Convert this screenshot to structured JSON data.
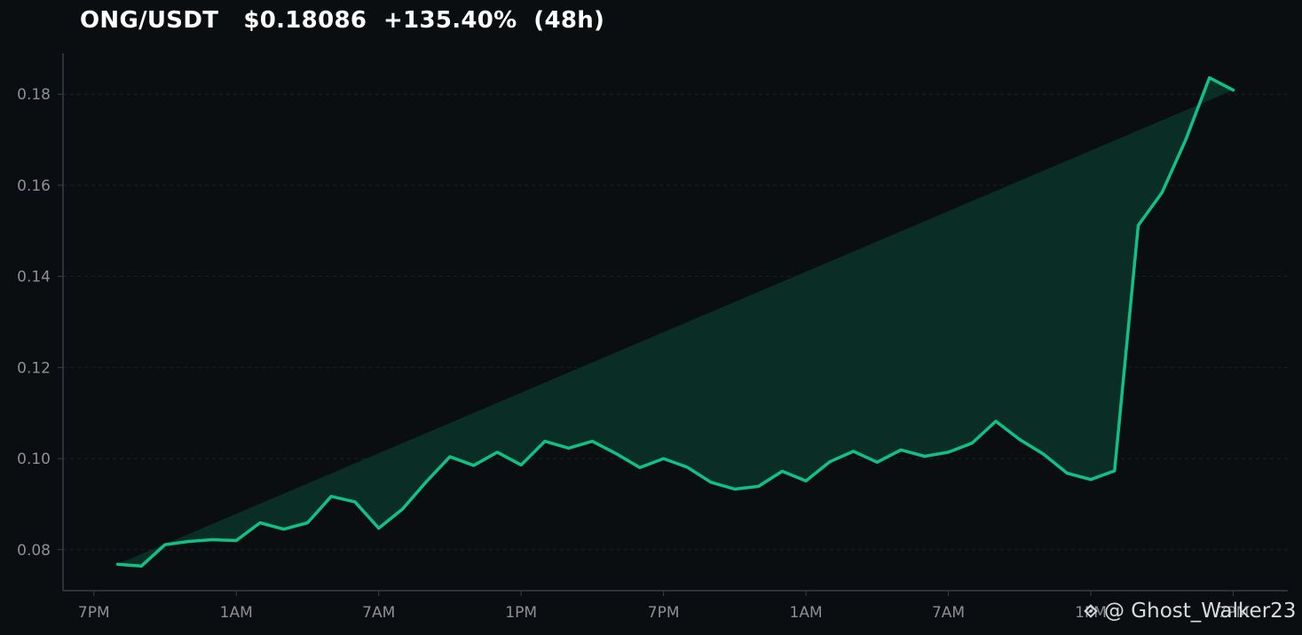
{
  "header": {
    "pair": "ONG/USDT",
    "price": "$0.18086",
    "change": "+135.40%",
    "period": "(48h)"
  },
  "watermark": {
    "handle": "@ Ghost_Walker23",
    "icon": "binance-logo-icon"
  },
  "colors": {
    "background": "#0b0e11",
    "line": "#10c184",
    "fill": "#0a2e25",
    "grid": "#1c2024",
    "axis": "#3a3f45",
    "tick_text": "#8a9096"
  },
  "chart_data": {
    "type": "area",
    "title": "ONG/USDT   $0.18086  +135.40%  (48h)",
    "xlabel": "",
    "ylabel": "",
    "x": [
      -1,
      0,
      1,
      2,
      3,
      4,
      5,
      6,
      7,
      8,
      9,
      10,
      11,
      12,
      13,
      14,
      15,
      16,
      17,
      18,
      19,
      20,
      21,
      22,
      23,
      24,
      25,
      26,
      27,
      28,
      29,
      30,
      31,
      32,
      33,
      34,
      35,
      36,
      37,
      38,
      39,
      40,
      41,
      42,
      43,
      44,
      45,
      46,
      47
    ],
    "y": [
      0.0768,
      0.0764,
      0.0811,
      0.0818,
      0.0822,
      0.082,
      0.0859,
      0.0845,
      0.0859,
      0.0917,
      0.0905,
      0.0847,
      0.0889,
      0.0949,
      0.1004,
      0.0985,
      0.1014,
      0.0986,
      0.1038,
      0.1023,
      0.1038,
      0.1011,
      0.098,
      0.1,
      0.0981,
      0.0948,
      0.0933,
      0.0939,
      0.0972,
      0.0951,
      0.0993,
      0.1016,
      0.0992,
      0.1019,
      0.1005,
      0.1014,
      0.1034,
      0.1082,
      0.1042,
      0.101,
      0.0968,
      0.0954,
      0.0973,
      0.1512,
      0.1584,
      0.17,
      0.1836,
      0.1809
    ],
    "x_ticks": [
      {
        "x": -2,
        "label": "7PM"
      },
      {
        "x": 4,
        "label": "1AM"
      },
      {
        "x": 10,
        "label": "7AM"
      },
      {
        "x": 16,
        "label": "1PM"
      },
      {
        "x": 22,
        "label": "7PM"
      },
      {
        "x": 28,
        "label": "1AM"
      },
      {
        "x": 34,
        "label": "7AM"
      },
      {
        "x": 40,
        "label": "1PM"
      },
      {
        "x": 46,
        "label": "7PM"
      }
    ],
    "y_ticks": [
      0.08,
      0.1,
      0.12,
      0.14,
      0.16,
      0.18
    ],
    "y_tick_labels": [
      "0.08",
      "0.10",
      "0.12",
      "0.14",
      "0.16",
      "0.18"
    ],
    "fill_baseline": 0.0764,
    "xlim": [
      -3.3,
      48.3
    ],
    "ylim": [
      0.071,
      0.189
    ],
    "grid": "horizontal-dashed",
    "legend": "none"
  }
}
